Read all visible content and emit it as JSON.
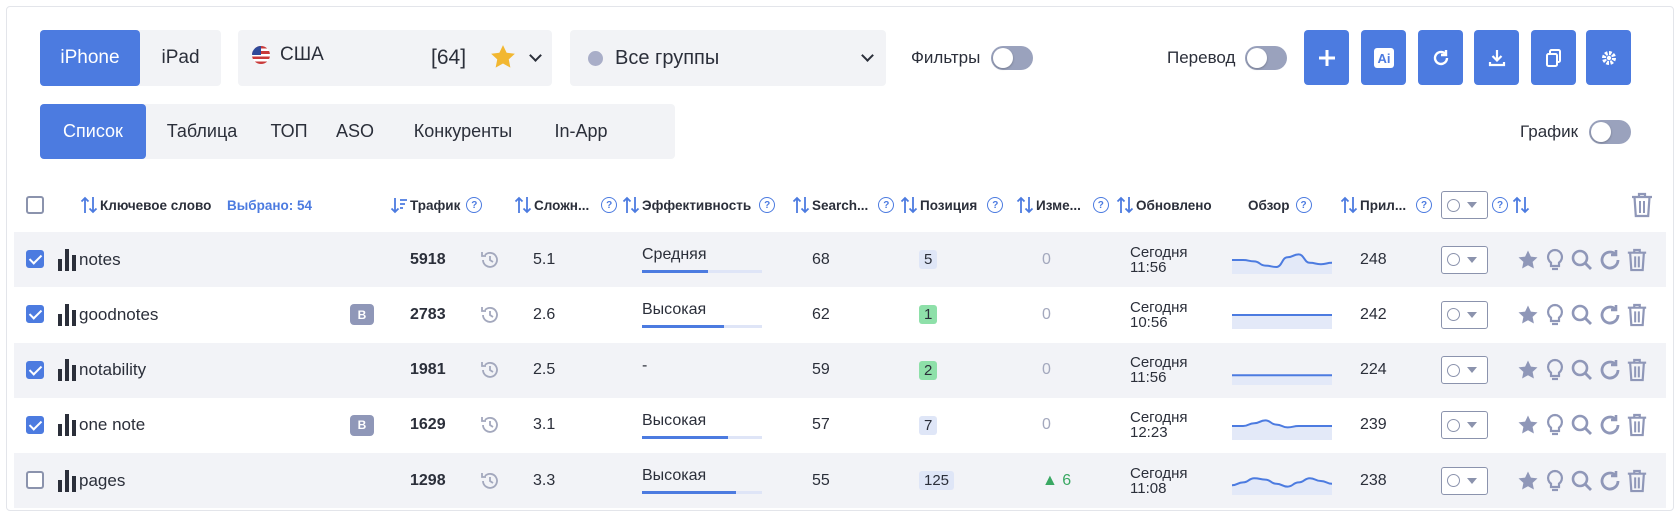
{
  "colors": {
    "accent": "#4c7be0",
    "muted_icon": "#8f97b8",
    "row_alt": "#f2f3f7",
    "positive": "#3aa863"
  },
  "device": {
    "options": [
      "iPhone",
      "iPad"
    ],
    "selected": "iPhone"
  },
  "country": {
    "name": "США",
    "count": "[64]",
    "icon": "us-flag-icon"
  },
  "groups": {
    "label": "Все группы"
  },
  "filters": {
    "label": "Фильтры",
    "enabled": false
  },
  "translate": {
    "label": "Перевод",
    "enabled": false
  },
  "chart_toggle": {
    "label": "График",
    "enabled": false
  },
  "actions": [
    "plus-icon",
    "ai-icon",
    "refresh-icon",
    "download-icon",
    "copy-icon",
    "gear-icon"
  ],
  "tabs": [
    {
      "label": "Список",
      "active": true
    },
    {
      "label": "Таблица"
    },
    {
      "label": "ТОП"
    },
    {
      "label": "ASO"
    },
    {
      "label": "Конкуренты"
    },
    {
      "label": "In-App"
    }
  ],
  "table": {
    "headers": {
      "keyword": "Ключевое слово",
      "selected": "Выбрано: 54",
      "traffic": "Трафик",
      "difficulty": "Сложн...",
      "efficiency": "Эффективность",
      "search": "Search...",
      "position": "Позиция",
      "change": "Изме...",
      "updated": "Обновлено",
      "overview": "Обзор",
      "apps": "Прил..."
    },
    "rows": [
      {
        "checked": true,
        "keyword": "notes",
        "badge": "",
        "traffic": "5918",
        "difficulty": "5.1",
        "efficiency": "Средняя",
        "efficiency_level": 0.55,
        "search": "68",
        "position": "5",
        "position_highlight": false,
        "change": "0",
        "updated_day": "Сегодня",
        "updated_time": "11:56",
        "apps": "248",
        "trend": [
          0.5,
          0.5,
          0.45,
          0.3,
          0.25,
          0.6,
          0.7,
          0.4,
          0.35,
          0.4
        ]
      },
      {
        "checked": true,
        "keyword": "goodnotes",
        "badge": "B",
        "traffic": "2783",
        "difficulty": "2.6",
        "efficiency": "Высокая",
        "efficiency_level": 0.68,
        "search": "62",
        "position": "1",
        "position_highlight": true,
        "change": "0",
        "updated_day": "Сегодня",
        "updated_time": "10:56",
        "apps": "242",
        "trend": [
          0.5,
          0.5,
          0.5,
          0.5,
          0.5,
          0.5,
          0.5,
          0.5,
          0.5,
          0.5
        ]
      },
      {
        "checked": true,
        "keyword": "notability",
        "badge": "",
        "traffic": "1981",
        "difficulty": "2.5",
        "efficiency": "-",
        "efficiency_level": 0,
        "search": "59",
        "position": "2",
        "position_highlight": true,
        "change": "0",
        "updated_day": "Сегодня",
        "updated_time": "11:56",
        "apps": "224",
        "trend": [
          0.35,
          0.35,
          0.35,
          0.35,
          0.35,
          0.35,
          0.35,
          0.35,
          0.35,
          0.35
        ]
      },
      {
        "checked": true,
        "keyword": "one note",
        "badge": "B",
        "traffic": "1629",
        "difficulty": "3.1",
        "efficiency": "Высокая",
        "efficiency_level": 0.72,
        "search": "57",
        "position": "7",
        "position_highlight": false,
        "change": "0",
        "updated_day": "Сегодня",
        "updated_time": "12:23",
        "apps": "239",
        "trend": [
          0.5,
          0.5,
          0.6,
          0.7,
          0.55,
          0.45,
          0.5,
          0.5,
          0.5,
          0.5
        ]
      },
      {
        "checked": false,
        "keyword": "pages",
        "badge": "",
        "traffic": "1298",
        "difficulty": "3.3",
        "efficiency": "Высокая",
        "efficiency_level": 0.78,
        "search": "55",
        "position": "125",
        "position_highlight": false,
        "change": "▲ 6",
        "change_up": true,
        "updated_day": "Сегодня",
        "updated_time": "11:08",
        "apps": "238",
        "trend": [
          0.35,
          0.45,
          0.6,
          0.55,
          0.4,
          0.3,
          0.45,
          0.6,
          0.5,
          0.4
        ]
      }
    ]
  }
}
